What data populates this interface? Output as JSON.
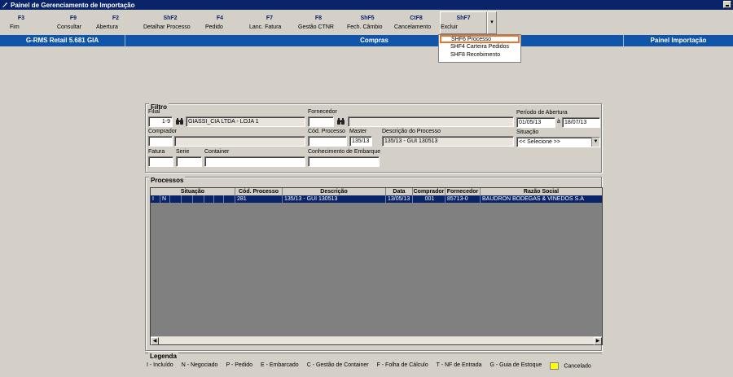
{
  "window": {
    "title": "Painel de Gerenciamento de Importação"
  },
  "toolbar": {
    "buttons": [
      {
        "key": "F3",
        "label": "Fim"
      },
      {
        "key": "F9",
        "label": "Consultar"
      },
      {
        "key": "F2",
        "label": "Abertura"
      },
      {
        "key": "ShF2",
        "label": "Detalhar Processo"
      },
      {
        "key": "F4",
        "label": "Pedido"
      },
      {
        "key": "F7",
        "label": "Lanc. Fatura"
      },
      {
        "key": "F8",
        "label": "Gestão CTNR"
      },
      {
        "key": "ShF5",
        "label": "Fech. Câmbio"
      },
      {
        "key": "CtF8",
        "label": "Cancelamento"
      },
      {
        "key": "ShF7",
        "label": "Excluir"
      }
    ]
  },
  "dropdown_menu": {
    "items": [
      "SHF6  Processo",
      "SHF4  Carteira Pedidos",
      "SHF8  Recebimento"
    ]
  },
  "bluebar": {
    "left": "G-RMS Retail 5.681 GIA",
    "center": "Compras",
    "right": "Painel Importação"
  },
  "filtro": {
    "title": "Filtro",
    "filial_label": "Filial",
    "filial_value": "1-9",
    "filial_name": "GIASSI_CIA LTDA - LOJA 1",
    "fornecedor_label": "Fornecedor",
    "fornecedor_value": "",
    "fornecedor_name": "",
    "periodo_label": "Período de Abertura",
    "periodo_de": "01/05/13",
    "periodo_sep": "à",
    "periodo_ate": "18/07/13",
    "comprador_label": "Comprador",
    "comprador_value": "",
    "comprador_name": "",
    "cod_processo_label": "Cód. Processo",
    "cod_processo_value": "",
    "master_label": "Master",
    "master_value": "135/13",
    "descricao_label": "Descrição do Processo",
    "descricao_value": "135/13 - GUI 130513",
    "situacao_label": "Situação",
    "situacao_value": "<< Selecione >>",
    "fatura_label": "Fatura",
    "serie_label": "Serie",
    "container_label": "Container",
    "conhecimento_label": "Conhecimento de Embarque"
  },
  "processos": {
    "title": "Processos",
    "columns": [
      "Situação",
      "Cód. Processo",
      "Descrição",
      "Data",
      "Comprador",
      "Fornecedor",
      "Razão Social"
    ],
    "row": {
      "sit1": "I",
      "sit2": "N",
      "cod": "281",
      "descricao": "135/13 - GUI 130513",
      "data": "13/05/13",
      "comprador": "001",
      "fornecedor": "85713-0",
      "razao": "BAUDRON BODEGAS & VINEDOS S.A"
    }
  },
  "legenda": {
    "title": "Legenda",
    "items": [
      "I - Incluído",
      "N - Negociado",
      "P - Pedido",
      "E - Embarcado",
      "C - Gestão de Container",
      "F - Folha de Cálculo",
      "T - NF de Entrada",
      "G - Guia de Estoque"
    ],
    "cancelado": "Cancelado",
    "cancelado_color": "#ffff00"
  },
  "colors": {
    "title_bar": "#0a246a",
    "blue_bar": "#1155aa",
    "menu_highlight": "#e8732a",
    "selected_row": "#0a246a"
  }
}
